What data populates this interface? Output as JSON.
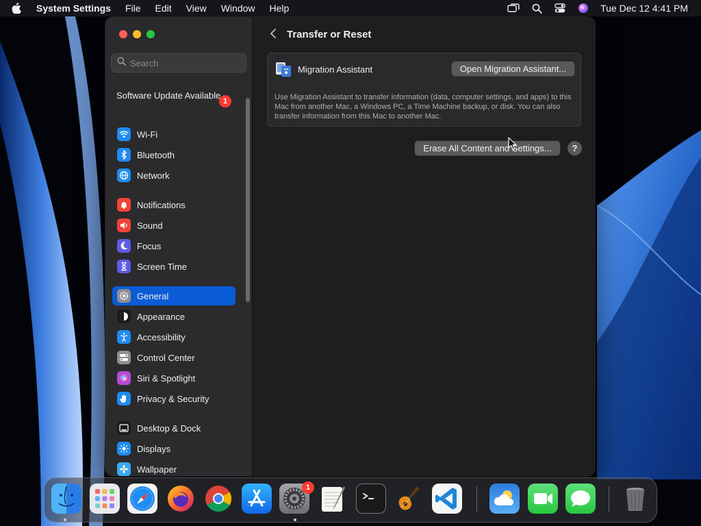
{
  "menubar": {
    "app_name": "System Settings",
    "items": [
      "File",
      "Edit",
      "View",
      "Window",
      "Help"
    ],
    "clock": "Tue Dec 12  4:41 PM"
  },
  "sidebar": {
    "search_placeholder": "Search",
    "update": {
      "label": "Software Update Available",
      "badge": "1"
    },
    "groups": [
      [
        {
          "label": "Wi-Fi",
          "icon": "wifi-icon",
          "color": "#1e8cf2"
        },
        {
          "label": "Bluetooth",
          "icon": "bluetooth-icon",
          "color": "#1e8cf2"
        },
        {
          "label": "Network",
          "icon": "globe-icon",
          "color": "#1e8cf2"
        }
      ],
      [
        {
          "label": "Notifications",
          "icon": "bell-icon",
          "color": "#f0443a"
        },
        {
          "label": "Sound",
          "icon": "speaker-icon",
          "color": "#f0443a"
        },
        {
          "label": "Focus",
          "icon": "moon-icon",
          "color": "#5e5ce6"
        },
        {
          "label": "Screen Time",
          "icon": "hourglass-icon",
          "color": "#5e5ce6"
        }
      ],
      [
        {
          "label": "General",
          "icon": "gear-icon",
          "color": "#8e8e93",
          "selected": true
        },
        {
          "label": "Appearance",
          "icon": "appearance-icon",
          "color": "#1c1c1e"
        },
        {
          "label": "Accessibility",
          "icon": "accessibility-icon",
          "color": "#1e8cf2"
        },
        {
          "label": "Control Center",
          "icon": "control-center-icon",
          "color": "#8e8e93"
        },
        {
          "label": "Siri & Spotlight",
          "icon": "siri-icon",
          "color": "#b24bd6"
        },
        {
          "label": "Privacy & Security",
          "icon": "hand-icon",
          "color": "#1e8cf2"
        }
      ],
      [
        {
          "label": "Desktop & Dock",
          "icon": "dock-icon",
          "color": "#1c1c1e"
        },
        {
          "label": "Displays",
          "icon": "sun-icon",
          "color": "#1e8cf2"
        },
        {
          "label": "Wallpaper",
          "icon": "wallpaper-icon",
          "color": "#38a9f5"
        }
      ]
    ]
  },
  "content": {
    "title": "Transfer or Reset",
    "migration_label": "Migration Assistant",
    "open_migration_button": "Open Migration Assistant...",
    "description": "Use Migration Assistant to transfer information (data, computer settings, and apps) to this Mac from another Mac, a Windows PC, a Time Machine backup, or disk. You can also transfer information from this Mac to another Mac.",
    "erase_button": "Erase All Content and Settings...",
    "help_button": "?"
  },
  "dock": {
    "apps": [
      "Finder",
      "Launchpad",
      "Safari",
      "Firefox",
      "Chrome",
      "App Store",
      "System Settings",
      "TextEdit",
      "Terminal",
      "GarageBand",
      "Visual Studio Code",
      "Weather",
      "FaceTime",
      "Messages",
      "Trash"
    ],
    "system_settings_badge": "1"
  }
}
